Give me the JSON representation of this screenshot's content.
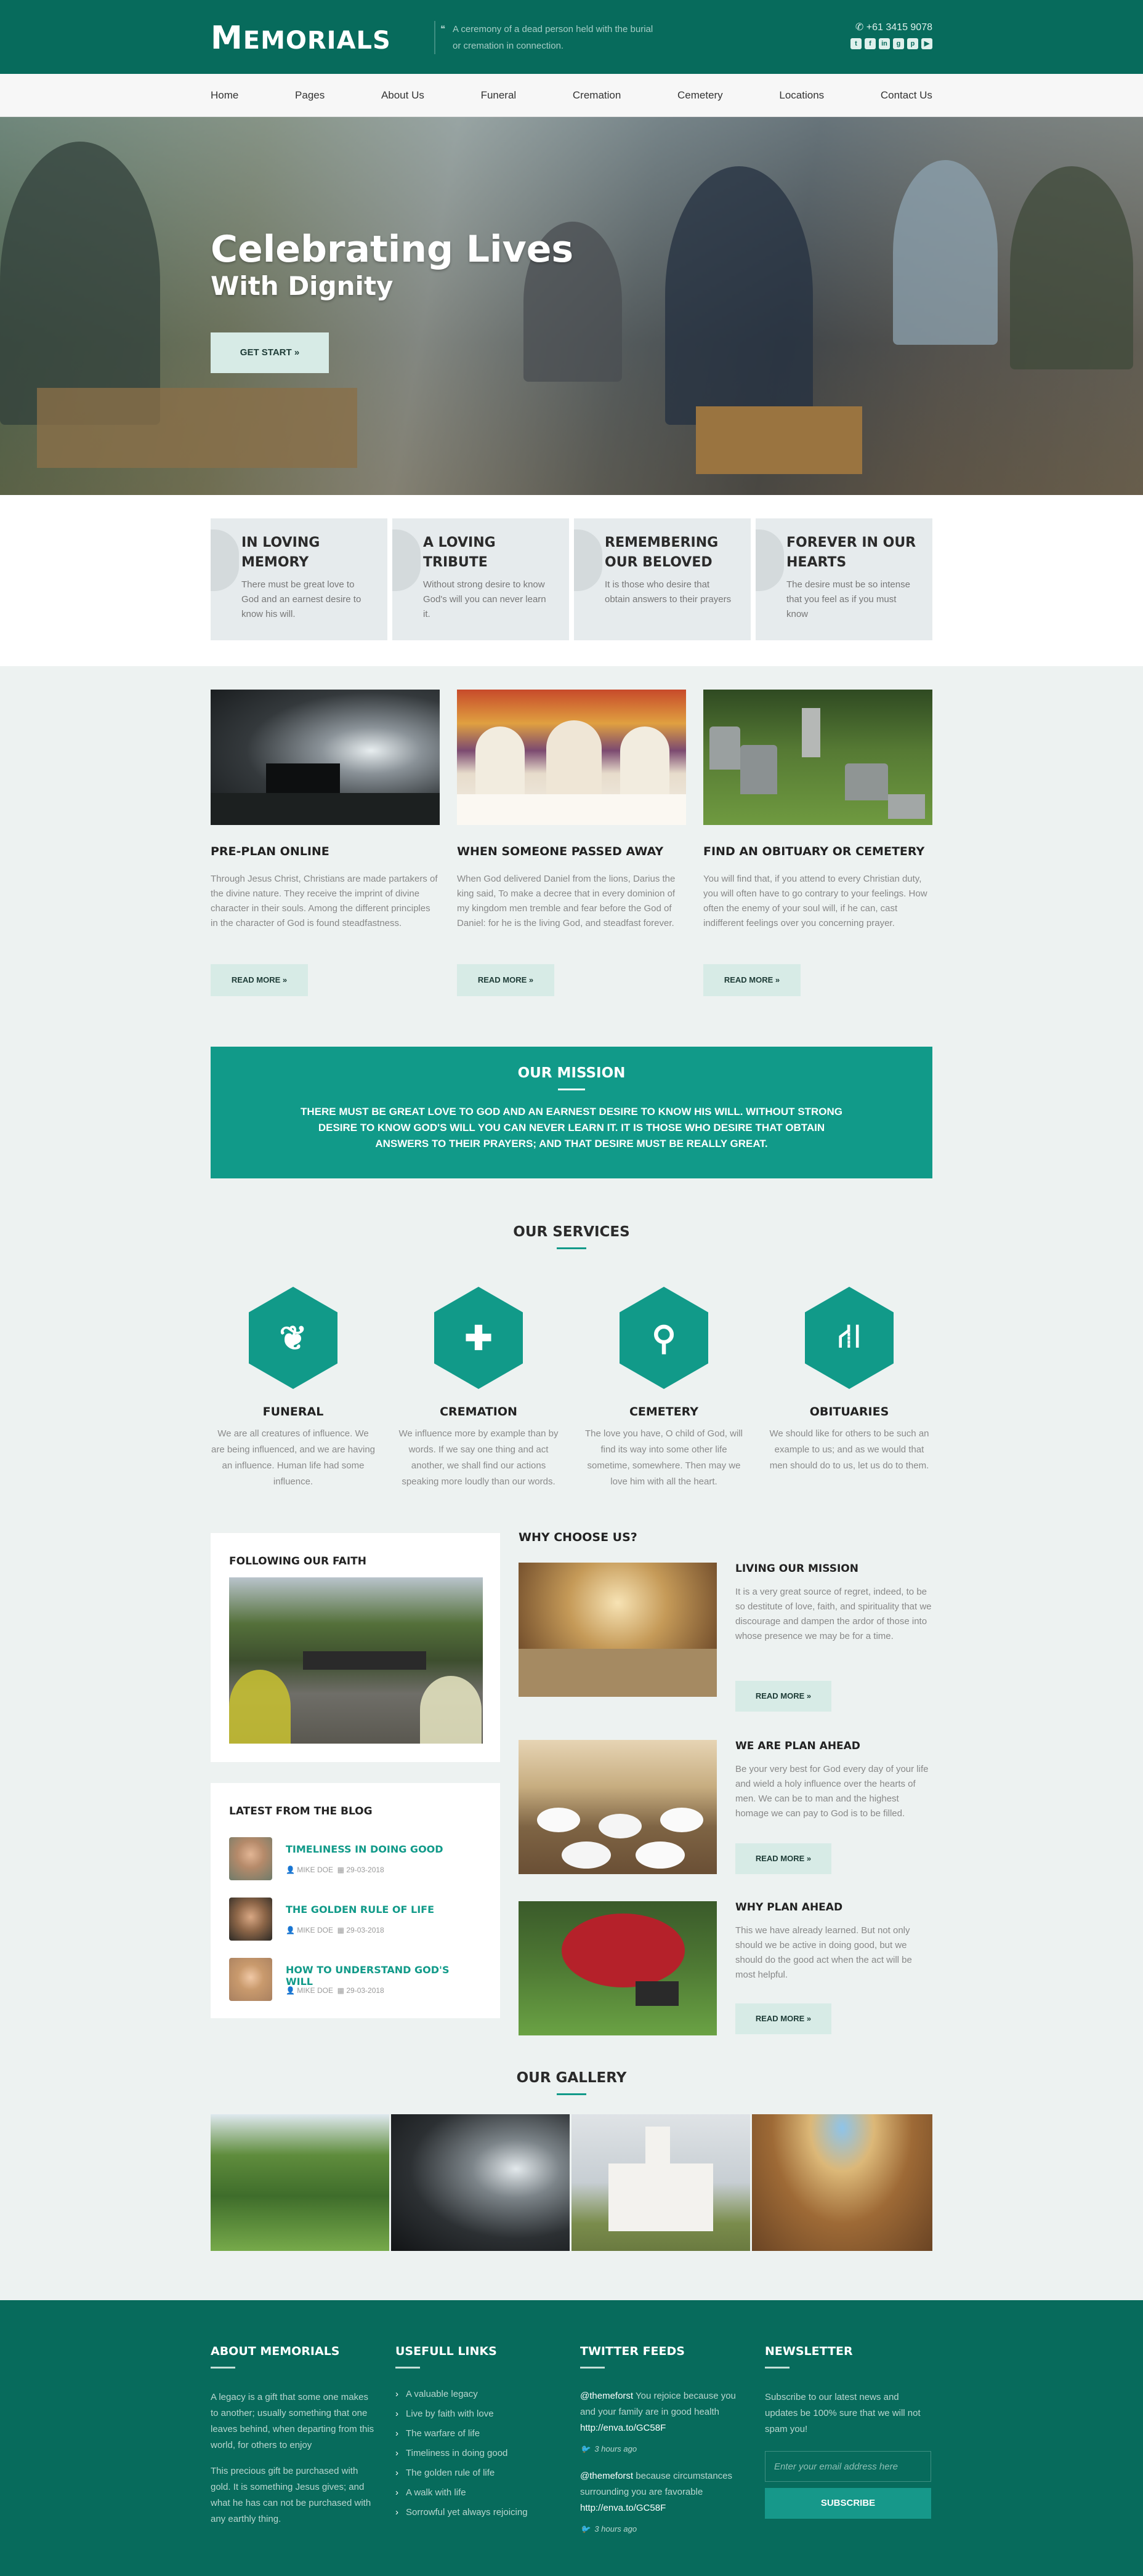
{
  "header": {
    "logo_big": "M",
    "logo_rest": "EMORIALS",
    "tagline": "A ceremony of a dead person held with the burial or cremation in connection.",
    "phone": "+61 3415 9078",
    "social_icons": [
      "twitter-icon",
      "facebook-icon",
      "linkedin-icon",
      "google-plus-icon",
      "pinterest-icon",
      "youtube-icon"
    ]
  },
  "nav": [
    "Home",
    "Pages",
    "About Us",
    "Funeral",
    "Cremation",
    "Cemetery",
    "Locations",
    "Contact Us"
  ],
  "hero": {
    "title": "Celebrating Lives",
    "subtitle": "With Dignity",
    "button": "GET START »"
  },
  "features": [
    {
      "title": "IN LOVING MEMORY",
      "text": "There must be great love to God and an earnest desire to know his will."
    },
    {
      "title": "A LOVING TRIBUTE",
      "text": "Without strong desire to know God's will you can never learn it."
    },
    {
      "title": "REMEMBERING OUR BELOVED",
      "text": "It is those who desire that obtain answers to their prayers"
    },
    {
      "title": "FOREVER IN OUR HEARTS",
      "text": "The desire must be so intense that you feel as if you must know"
    }
  ],
  "cards": [
    {
      "title": "PRE-PLAN ONLINE",
      "text": "Through Jesus Christ, Christians are made partakers of the divine nature. They receive the imprint of divine character in their souls. Among the different principles in the character of God is found steadfastness.",
      "button": "READ MORE »"
    },
    {
      "title": "WHEN SOMEONE PASSED AWAY",
      "text": "When God delivered Daniel from the lions, Darius the king said, To make a decree that in every dominion of my kingdom men tremble and fear before the God of Daniel: for he is the living God, and steadfast forever.",
      "button": "READ MORE »"
    },
    {
      "title": "FIND AN OBITUARY OR CEMETERY",
      "text": "You will find that, if you attend to every Christian duty, you will often have to go contrary to your feelings. How often the enemy of your soul will, if he can, cast indifferent feelings over you concerning prayer.",
      "button": "READ MORE »"
    }
  ],
  "mission": {
    "title": "OUR MISSION",
    "text": "THERE MUST BE GREAT LOVE TO GOD AND AN EARNEST DESIRE TO KNOW HIS WILL. WITHOUT STRONG DESIRE TO KNOW GOD'S WILL YOU CAN NEVER LEARN IT. IT IS THOSE WHO DESIRE THAT OBTAIN ANSWERS TO THEIR PRAYERS; AND THAT DESIRE MUST BE REALLY GREAT."
  },
  "services": {
    "title": "OUR SERVICES",
    "items": [
      {
        "title": "FUNERAL",
        "icon": "leaf-icon",
        "text": "We are all creatures of influence. We are being influenced, and we are having an influence. Human life had some influence."
      },
      {
        "title": "CREMATION",
        "icon": "first-aid-kit-icon",
        "text": "We influence more by example than by words. If we say one thing and act another, we shall find our actions speaking more loudly than our words."
      },
      {
        "title": "CEMETERY",
        "icon": "map-pin-icon",
        "text": "The love you have, O child of God, will find its way into some other life sometime, somewhere. Then may we love him with all the heart."
      },
      {
        "title": "OBITUARIES",
        "icon": "road-icon",
        "text": "We should like for others to be such an example to us; and as we would that men should do to us, let us do to them."
      }
    ]
  },
  "faith": {
    "title": "FOLLOWING OUR FAITH"
  },
  "blog": {
    "title": "LATEST FROM THE BLOG",
    "posts": [
      {
        "title": "TIMELINESS IN DOING GOOD",
        "author": "MIKE DOE",
        "date": "29-03-2018"
      },
      {
        "title": "THE GOLDEN RULE OF LIFE",
        "author": "MIKE DOE",
        "date": "29-03-2018"
      },
      {
        "title": "HOW TO UNDERSTAND GOD'S WILL",
        "author": "MIKE DOE",
        "date": "29-03-2018"
      }
    ]
  },
  "why": {
    "title": "WHY CHOOSE US?",
    "items": [
      {
        "title": "LIVING OUR MISSION",
        "text": "It is a very great source of regret, indeed, to be so destitute of love, faith, and spirituality that we discourage and dampen the ardor of those into whose presence we may be for a time.",
        "button": "READ MORE »"
      },
      {
        "title": "WE ARE PLAN AHEAD",
        "text": "Be your very best for God every day of your life and wield a holy influence over the hearts of men. We can be to man and the highest homage we can pay to God is to be filled.",
        "button": "READ MORE »"
      },
      {
        "title": "WHY PLAN AHEAD",
        "text": "This we have already learned. But not only should we be active in doing good, but we should do the good act when the act will be most helpful.",
        "button": "READ MORE »"
      }
    ]
  },
  "gallery": {
    "title": "OUR GALLERY"
  },
  "footer": {
    "about": {
      "title": "ABOUT MEMORIALS",
      "p1": "A legacy is a gift that some one makes to another; usually something that one leaves behind, when departing from this world, for others to enjoy",
      "p2": "This precious gift be purchased with gold. It is something Jesus gives; and what he has can not be purchased with any earthly thing."
    },
    "links": {
      "title": "USEFULL LINKS",
      "items": [
        "A valuable legacy",
        "Live by faith with love",
        "The warfare of life",
        "Timeliness in doing good",
        "The golden rule of life",
        "A walk with life",
        "Sorrowful yet always rejoicing"
      ]
    },
    "twitter": {
      "title": "TWITTER FEEDS",
      "tweets": [
        {
          "handle": "@themeforst",
          "text": "You rejoice because you and your family are in good health",
          "link": "http://enva.to/GC58F",
          "time": "3 hours ago"
        },
        {
          "handle": "@themeforst",
          "text": "because circumstances surrounding you are favorable",
          "link": "http://enva.to/GC58F",
          "time": "3 hours ago"
        }
      ]
    },
    "newsletter": {
      "title": "NEWSLETTER",
      "text": "Subscribe to our latest news and updates be 100% sure that we will not spam you!",
      "placeholder": "Enter your email address here",
      "button": "SUBSCRIBE"
    }
  }
}
